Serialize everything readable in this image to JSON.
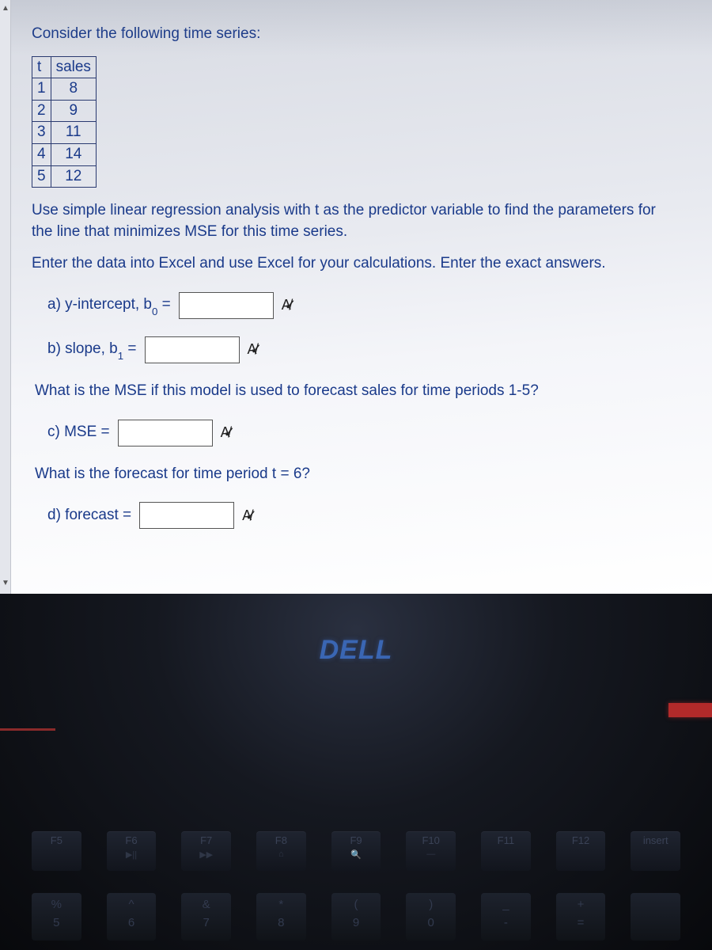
{
  "question": {
    "intro": "Consider the following time series:",
    "table": {
      "headers": [
        "t",
        "sales"
      ],
      "rows": [
        [
          "1",
          "8"
        ],
        [
          "2",
          "9"
        ],
        [
          "3",
          "11"
        ],
        [
          "4",
          "14"
        ],
        [
          "5",
          "12"
        ]
      ]
    },
    "para1": "Use simple linear regression analysis with t as the predictor variable to find the parameters for the line that minimizes MSE for this time series.",
    "para2": "Enter the data into Excel and use Excel for your calculations. Enter the exact answers.",
    "a_prefix": "a) y-intercept, b",
    "a_sub": "0",
    "a_suffix": " =",
    "b_prefix": "b) slope, b",
    "b_sub": "1",
    "b_suffix": " =",
    "para3": "What is the MSE if this model is used to forecast sales for time periods 1-5?",
    "c_label": "c) MSE =",
    "para4": "What is the forecast for time period t = 6?",
    "d_label": "d) forecast =",
    "check_glyph": "A̸ ✓"
  },
  "laptop": {
    "logo": "DELL",
    "fkeys": [
      "F5",
      "F6",
      "F7",
      "F8",
      "F9",
      "F10",
      "F11",
      "F12",
      "insert"
    ],
    "fsyms": [
      "",
      "▶||",
      "▶▶",
      "⌂",
      "🔍",
      "—",
      "",
      "",
      ""
    ],
    "numkeys_top": [
      "%",
      "^",
      "&",
      "*",
      "(",
      ")",
      "_",
      "+",
      ""
    ],
    "numkeys_bot": [
      "5",
      "6",
      "7",
      "8",
      "9",
      "0",
      "-",
      "=",
      ""
    ]
  }
}
